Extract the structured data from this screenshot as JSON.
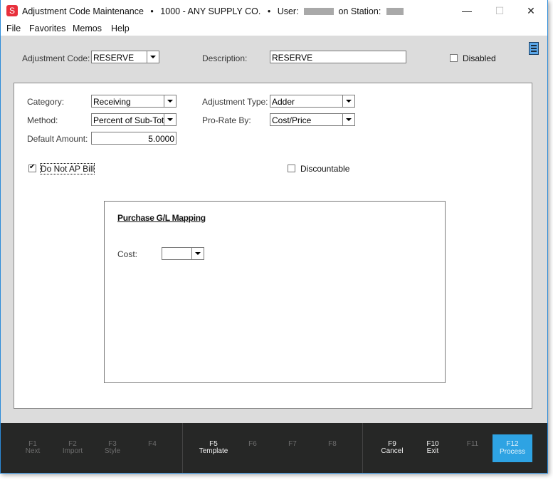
{
  "window": {
    "app_icon_letter": "S",
    "title_parts": [
      "Adjustment Code Maintenance",
      "•",
      "1000 - ANY SUPPLY CO.",
      "•",
      "User:"
    ],
    "title_station": "on Station:",
    "controls": {
      "minimize": "—",
      "maximize": "☐",
      "close": "✕"
    }
  },
  "menu": [
    "File",
    "Favorites",
    "Memos",
    "Help"
  ],
  "header": {
    "adjustment_code_label": "Adjustment Code:",
    "adjustment_code_value": "RESERVE",
    "description_label": "Description:",
    "description_value": "RESERVE",
    "disabled_label": "Disabled",
    "disabled_checked": false,
    "options_icon": "hamburger-list-icon"
  },
  "form": {
    "category_label": "Category:",
    "category_value": "Receiving",
    "method_label": "Method:",
    "method_value": "Percent of Sub-Total",
    "default_amount_label": "Default Amount:",
    "default_amount_value": "5.0000",
    "adjustment_type_label": "Adjustment Type:",
    "adjustment_type_value": "Adder",
    "prorate_label": "Pro-Rate By:",
    "prorate_value": "Cost/Price",
    "do_not_ap_bill_label": "Do Not AP Bill",
    "do_not_ap_bill_checked": true,
    "discountable_label": "Discountable",
    "discountable_checked": false
  },
  "gl_mapping": {
    "title": "Purchase G/L Mapping",
    "cost_label": "Cost:",
    "cost_value": ""
  },
  "function_keys": [
    {
      "key": "F1",
      "label": "Next",
      "enabled": false
    },
    {
      "key": "F2",
      "label": "Import",
      "enabled": false
    },
    {
      "key": "F3",
      "label": "Style",
      "enabled": false
    },
    {
      "key": "F4",
      "label": "",
      "enabled": false
    },
    {
      "key": "F5",
      "label": "Template",
      "enabled": true
    },
    {
      "key": "F6",
      "label": "",
      "enabled": false
    },
    {
      "key": "F7",
      "label": "",
      "enabled": false
    },
    {
      "key": "F8",
      "label": "",
      "enabled": false
    },
    {
      "key": "F9",
      "label": "Cancel",
      "enabled": true
    },
    {
      "key": "F10",
      "label": "Exit",
      "enabled": true
    },
    {
      "key": "F11",
      "label": "",
      "enabled": false
    },
    {
      "key": "F12",
      "label": "Process",
      "enabled": true,
      "primary": true
    }
  ],
  "colors": {
    "accent": "#2ea3e3",
    "function_bar": "#262726",
    "window_border": "#2b8ad8",
    "app_icon": "#e8303c"
  }
}
